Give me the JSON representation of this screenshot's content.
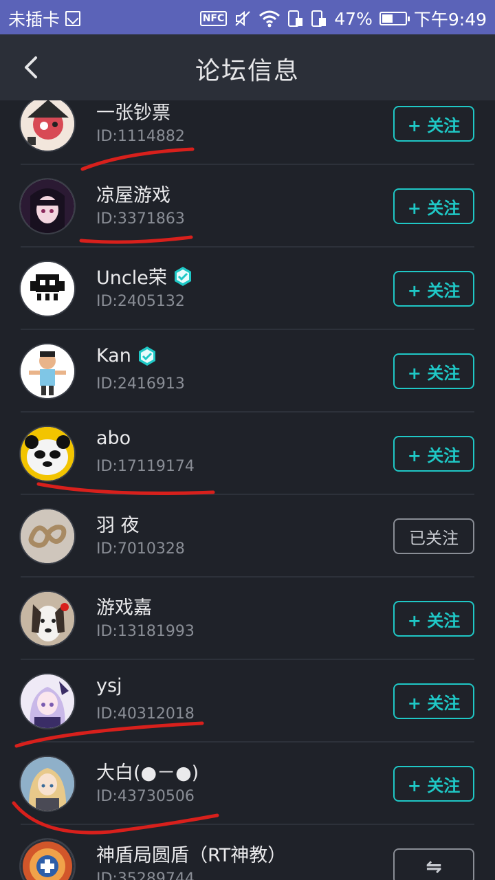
{
  "status_bar": {
    "carrier": "未插卡",
    "battery": "47%",
    "battery_level": 0.47,
    "time": "下午9:49",
    "icons": [
      "sim-icon",
      "nfc-icon",
      "mute-icon",
      "wifi-icon",
      "data-icon",
      "data-icon",
      "battery-icon"
    ]
  },
  "header": {
    "title": "论坛信息",
    "back_icon": "chevron-left-icon"
  },
  "follow_label": "+ 关注",
  "followed_label": "已关注",
  "mutual_label": "⇋",
  "users": [
    {
      "name": "一张钞票",
      "id": "ID:1114882",
      "verified": false,
      "state": "follow"
    },
    {
      "name": "凉屋游戏",
      "id": "ID:3371863",
      "verified": false,
      "state": "follow"
    },
    {
      "name": "Uncle荣",
      "id": "ID:2405132",
      "verified": true,
      "state": "follow"
    },
    {
      "name": "Kan",
      "id": "ID:2416913",
      "verified": true,
      "state": "follow"
    },
    {
      "name": "abo",
      "id": "ID:17119174",
      "verified": false,
      "state": "follow"
    },
    {
      "name": "羽 夜",
      "id": "ID:7010328",
      "verified": false,
      "state": "followed"
    },
    {
      "name": "游戏嘉",
      "id": "ID:13181993",
      "verified": false,
      "state": "follow"
    },
    {
      "name": "ysj",
      "id": "ID:40312018",
      "verified": false,
      "state": "follow"
    },
    {
      "name": "大白(●－●)",
      "id": "ID:43730506",
      "verified": false,
      "state": "follow"
    },
    {
      "name": "神盾局圆盾（RT神教）",
      "id": "ID:35289744",
      "verified": false,
      "state": "mutual"
    }
  ],
  "colors": {
    "accent": "#1fc8c6",
    "status_bar": "#5b63b8",
    "background": "#1f2229",
    "header": "#2b2f38",
    "annotation": "#d8201c"
  }
}
